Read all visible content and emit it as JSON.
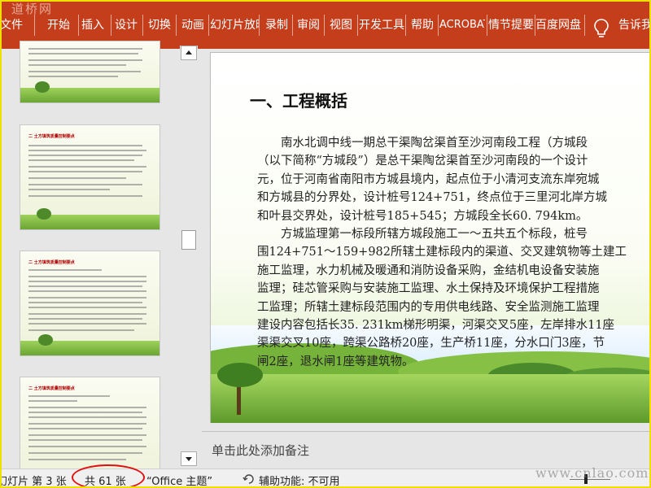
{
  "watermark_top": "道桥网",
  "watermark_bottom": "www.cnlao.com",
  "ribbon": {
    "tabs": [
      {
        "label": "文件"
      },
      {
        "label": "开始"
      },
      {
        "label": "插入"
      },
      {
        "label": "设计"
      },
      {
        "label": "切换"
      },
      {
        "label": "动画"
      },
      {
        "label": "幻灯片放映"
      },
      {
        "label": "录制"
      },
      {
        "label": "审阅"
      },
      {
        "label": "视图"
      },
      {
        "label": "开发工具"
      },
      {
        "label": "帮助"
      },
      {
        "label": "ACROBAT"
      },
      {
        "label": "情节提要"
      },
      {
        "label": "百度网盘"
      }
    ],
    "tell_me": "告诉我",
    "icons": [
      "lightbulb-icon"
    ]
  },
  "thumbnails": [
    {
      "heading": ""
    },
    {
      "heading": "二 土方填筑质量控制要点"
    },
    {
      "heading": "二 土方填筑质量控制要点"
    },
    {
      "heading": "二 土方填筑质量控制要点"
    }
  ],
  "slide": {
    "title": "一、工程概括",
    "lines": [
      "　　南水北调中线一期总干渠陶岔渠首至沙河南段工程（方城段",
      "（以下简称“方城段”）是总干渠陶岔渠首至沙河南段的一个设计",
      "元，位于河南省南阳市方城县境内，起点位于小清河支流东岸宛城",
      "和方城县的分界处，设计桩号124+751，终点位于三里河北岸方城",
      "和叶县交界处，设计桩号185+545；方城段全长60. 794km。",
      "　　方城监理第一标段所辖方城段施工一～五共五个标段，桩号",
      "围124+751～159+982所辖土建标段内的渠道、交叉建筑物等土建工",
      "施工监理，水力机械及暖通和消防设备采购，金结机电设备安装施",
      "监理；硅芯管采购与安装施工监理、水土保持及环境保护工程措施",
      "工监理；所辖土建标段范围内的专用供电线路、安全监测施工监理",
      "建设内容包括长35. 231km梯形明渠，河渠交叉5座，左岸排水11座",
      "渠渠交叉10座，跨渠公路桥20座，生产桥11座，分水口门3座，节",
      "闸2座，退水闸1座等建筑物。"
    ]
  },
  "notes_placeholder": "单击此处添加备注",
  "status": {
    "slide_pos": "幻灯片 第 3 张",
    "slide_total": "共 61 张",
    "theme": "“Office 主题”",
    "accessibility": "辅助功能: 不可用"
  },
  "colors": {
    "ribbon": "#c43e1c",
    "annotation_circle": "#e01010"
  }
}
